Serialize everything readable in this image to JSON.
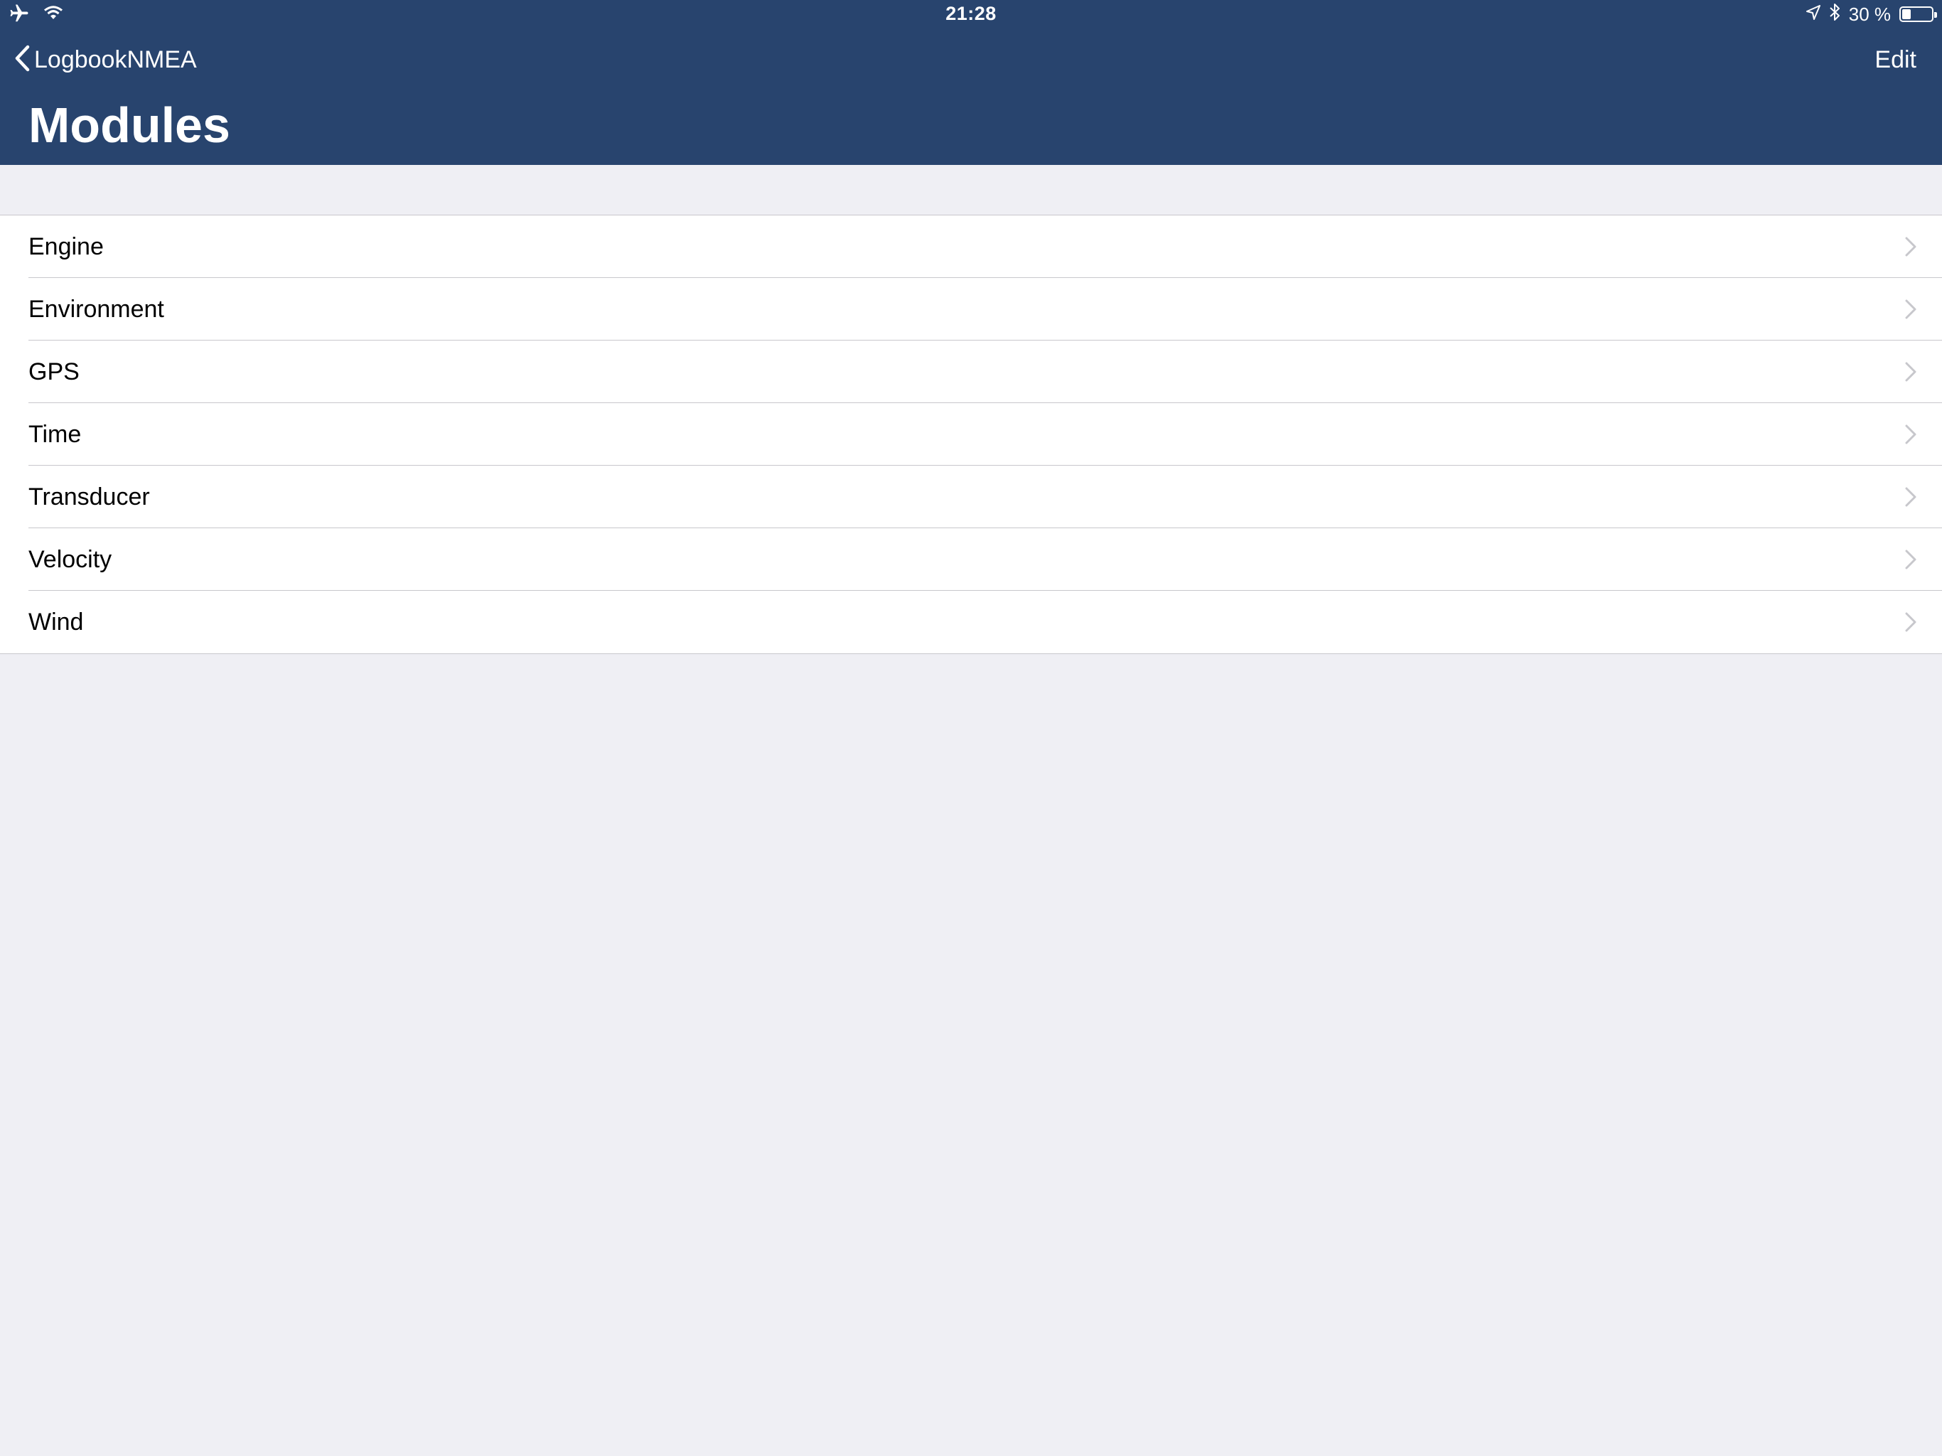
{
  "status_bar": {
    "time": "21:28",
    "battery_text": "30 %",
    "battery_level": 0.3,
    "icons": [
      "airplane-icon",
      "wifi-icon",
      "location-icon",
      "bluetooth-icon",
      "battery-icon"
    ]
  },
  "nav": {
    "back_label": "LogbookNMEA",
    "edit_label": "Edit",
    "title": "Modules"
  },
  "list": {
    "items": [
      {
        "label": "Engine"
      },
      {
        "label": "Environment"
      },
      {
        "label": "GPS"
      },
      {
        "label": "Time"
      },
      {
        "label": "Transducer"
      },
      {
        "label": "Velocity"
      },
      {
        "label": "Wind"
      }
    ]
  },
  "colors": {
    "nav_background": "#28446e",
    "page_background": "#efeff4",
    "cell_background": "#ffffff",
    "separator": "#c8c7cc",
    "chevron": "#c7c7cc"
  }
}
